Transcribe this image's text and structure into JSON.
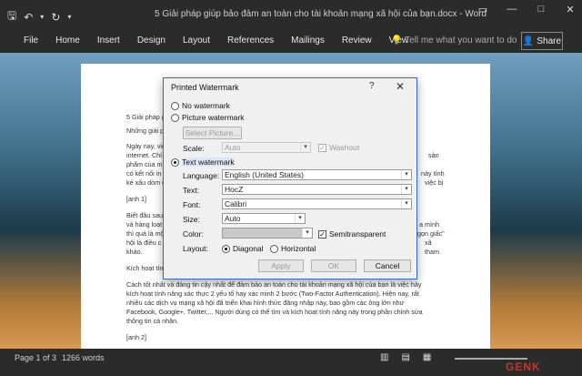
{
  "window": {
    "title": "5 Giải pháp giúp bảo đảm an toàn cho tài khoản mạng xã hội của bạn.docx - Word"
  },
  "ribbon": {
    "tabs": [
      "File",
      "Home",
      "Insert",
      "Design",
      "Layout",
      "References",
      "Mailings",
      "Review",
      "View"
    ],
    "tell_me": "Tell me what you want to do",
    "share": "Share"
  },
  "document": {
    "lines": [
      "5 Giải pháp g",
      "Những giải p",
      "Ngày nay, việ",
      "internet. Chí",
      "phẩm của m",
      "có kết nối in",
      "kẻ xấu dòm d",
      "[anh 1]",
      "Biết đâu sau",
      "và hàng loạt",
      "thì quả là mộ",
      "hội là điều c",
      "khảo.",
      "Kích hoạt tín",
      "Cách tốt nhất và đảng tin cậy nhất để đảm bảo an toàn cho tài khoản mạng xã hội của bạn là việc hãy",
      "kích hoạt tính năng xác thực 2 yếu tố hay xác minh 2 bước (Two-Factor Authentication). Hiện nay, rất",
      "nhiều các dịch vụ mạng xã hội đã triển khai hình thức đăng nhập này, bao gồm các ông lớn như",
      "Facebook, Google+, Twitter,... Người dùng có thể tìm và kích hoạt tính năng này trong phần chỉnh sửa",
      "thông tin cá nhân.",
      "[anh 2]"
    ],
    "right_fragments": [
      "sản",
      "náy tính",
      "việc bị",
      "a mình",
      "gọn giấc\"",
      "xã",
      "tham"
    ]
  },
  "status": {
    "page": "Page 1 of 3",
    "words": "1266 words"
  },
  "watermark_logo": "GENK",
  "dialog": {
    "title": "Printed Watermark",
    "help": "?",
    "close": "✕",
    "no_watermark": "No watermark",
    "picture_watermark": "Picture watermark",
    "select_picture": "Select Picture...",
    "scale_label": "Scale:",
    "scale_value": "Auto",
    "washout": "Washout",
    "text_watermark": "Text watermark",
    "language_label": "Language:",
    "language_value": "English (United States)",
    "text_label": "Text:",
    "text_value": "HocZ",
    "font_label": "Font:",
    "font_value": "Calibri",
    "size_label": "Size:",
    "size_value": "Auto",
    "color_label": "Color:",
    "semitransparent": "Semitransparent",
    "layout_label": "Layout:",
    "diagonal": "Diagonal",
    "horizontal": "Horizontal",
    "apply": "Apply",
    "ok": "OK",
    "cancel": "Cancel"
  }
}
